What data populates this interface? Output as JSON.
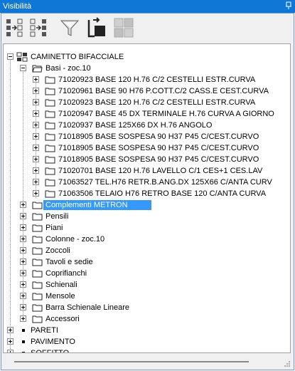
{
  "window": {
    "title": "Visibilità"
  },
  "toolbar": {
    "buttons": [
      {
        "icon": "expand-all-icon"
      },
      {
        "icon": "collapse-all-icon"
      },
      {
        "icon": "filter-icon"
      },
      {
        "icon": "export-icon"
      },
      {
        "icon": "grid-icon"
      }
    ]
  },
  "tree": {
    "root": "CAMINETTO BIFACCIALE",
    "basi": "Basi - zoc.10",
    "basi_items": [
      "71020923 BASE 120 H.76 C/2 CESTELLI ESTR.CURVA",
      "71020961 BASE 90 H76 P.COTT.C/2 CASS.E CEST.CURVA",
      "71020923 BASE 120 H.76 C/2 CESTELLI ESTR.CURVA",
      "71020947 BASE 45 DX TERMINALE H.76 CURVA A GIORNO",
      "71020937 BASE 125X66 DX H.76 ANGOLO",
      "71018905 BASE SOSPESA  90 H37 P45 C/CEST.CURVO",
      "71018905 BASE SOSPESA  90 H37 P45 C/CEST.CURVO",
      "71018905 BASE SOSPESA  90 H37 P45 C/CEST.CURVO",
      "71020701 BASE 120 H.76 LAVELLO C/1 CES+1 CES.LAV",
      "71063527 TEL.H76 RETR.B.ANG.DX 125X66 C/ANTA CURV",
      "71063506 TELAIO H76 RETRO BASE 120 C/ANTA CURVA"
    ],
    "groups": [
      "Complementi METRON",
      "Pensili",
      "Piani",
      "Colonne - zoc.10",
      "Zoccoli",
      "Tavoli e sedie",
      "Coprifianchi",
      "Schienali",
      "Mensole",
      "Barra Schienale Lineare",
      "Accessori"
    ],
    "top_level": [
      "PARETI",
      "PAVIMENTO",
      "SOFFITTO"
    ]
  }
}
